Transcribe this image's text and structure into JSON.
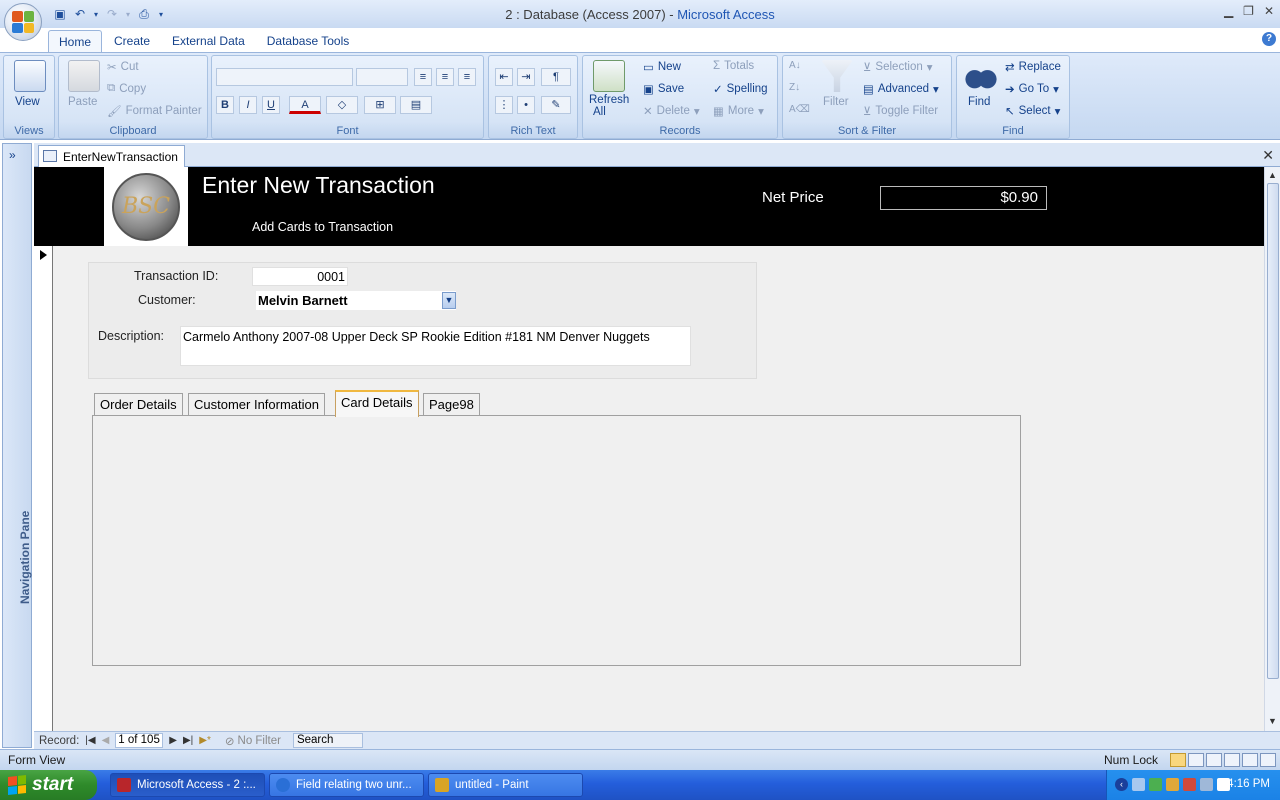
{
  "window": {
    "title_prefix": "2 : Database (Access 2007) - ",
    "app_name": "Microsoft Access"
  },
  "ribbon": {
    "tabs": [
      {
        "label": "Home",
        "active": true
      },
      {
        "label": "Create",
        "active": false
      },
      {
        "label": "External Data",
        "active": false
      },
      {
        "label": "Database Tools",
        "active": false
      }
    ],
    "groups": {
      "views": {
        "label": "Views",
        "view": "View"
      },
      "clipboard": {
        "label": "Clipboard",
        "paste": "Paste",
        "cut": "Cut",
        "copy": "Copy",
        "format_painter": "Format Painter"
      },
      "font": {
        "label": "Font",
        "bold": "B",
        "italic": "I",
        "underline": "U",
        "font_color": "A"
      },
      "rich_text": {
        "label": "Rich Text"
      },
      "records": {
        "label": "Records",
        "refresh": "Refresh",
        "refresh_sub": "All",
        "new": "New",
        "save": "Save",
        "delete": "Delete",
        "totals": "Totals",
        "spelling": "Spelling",
        "more": "More"
      },
      "sort_filter": {
        "label": "Sort & Filter",
        "filter": "Filter",
        "selection": "Selection",
        "advanced": "Advanced",
        "toggle_filter": "Toggle Filter"
      },
      "find": {
        "label": "Find",
        "find": "Find",
        "replace": "Replace",
        "goto": "Go To",
        "select": "Select"
      }
    }
  },
  "nav_pane": {
    "label": "Navigation Pane",
    "toggle": "»"
  },
  "document_tab": {
    "label": "EnterNewTransaction"
  },
  "form": {
    "header": {
      "logo_text": "BSC",
      "title": "Enter New Transaction",
      "subtitle": "Add Cards to Transaction",
      "net_price_label": "Net Price",
      "net_price_value": "$0.90"
    },
    "fields": {
      "transaction_id_label": "Transaction ID:",
      "transaction_id_value": "0001",
      "customer_label": "Customer:",
      "customer_value": "Melvin Barnett",
      "description_label": "Description:",
      "description_value": "Carmelo Anthony 2007-08 Upper Deck SP Rookie Edition #181 NM Denver Nuggets"
    },
    "tabs": [
      {
        "label": "Order Details",
        "active": false
      },
      {
        "label": "Customer Information",
        "active": false
      },
      {
        "label": "Card Details",
        "active": true
      },
      {
        "label": "Page98",
        "active": false
      }
    ]
  },
  "record_nav": {
    "label": "Record:",
    "position": "1 of 105",
    "no_filter": "No Filter",
    "search": "Search"
  },
  "status_bar": {
    "view": "Form View",
    "num_lock": "Num Lock"
  },
  "taskbar": {
    "start": "start",
    "tasks": [
      {
        "label": "Microsoft Access - 2 :...",
        "active": true,
        "icon_color": "#b8262b"
      },
      {
        "label": "Field relating two unr...",
        "active": false,
        "icon_color": "#2a6fd6"
      },
      {
        "label": "untitled - Paint",
        "active": false,
        "icon_color": "#d8a425"
      }
    ],
    "clock": "4:16 PM"
  },
  "colors": {
    "ribbon_text": "#15428b",
    "header_bg": "#000000",
    "taskbar_blue": "#245edb",
    "start_green": "#3a9a35"
  }
}
